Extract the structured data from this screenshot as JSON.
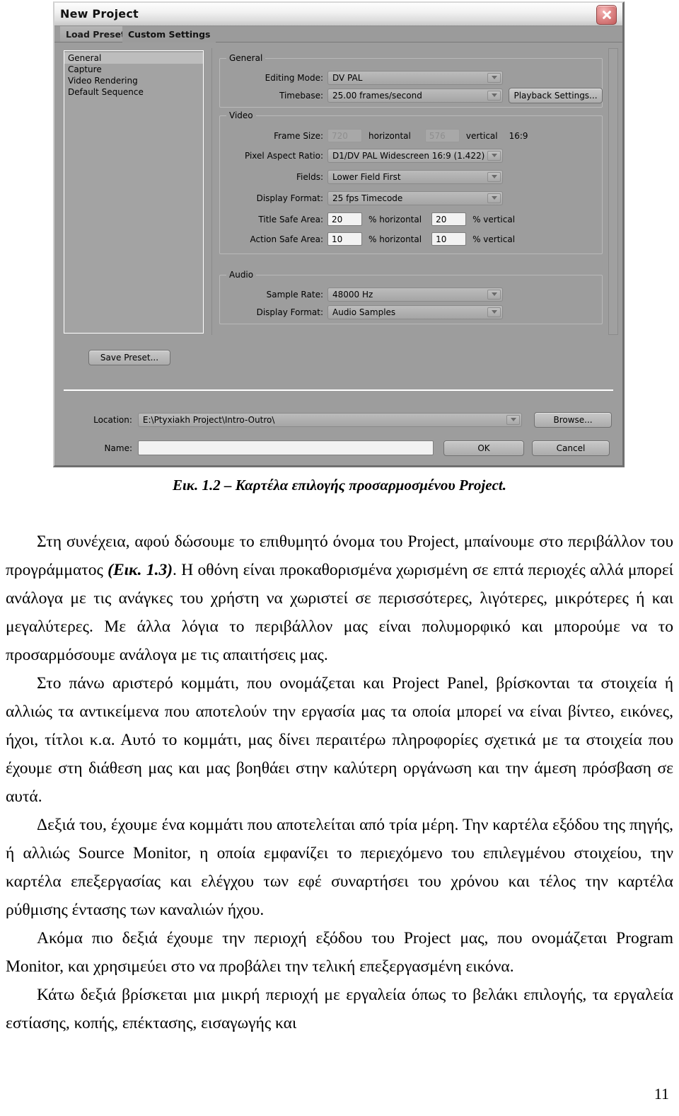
{
  "dialog": {
    "title": "New Project",
    "close_icon": "close-icon",
    "tabs": [
      {
        "label": "Load Preset",
        "active": false
      },
      {
        "label": "Custom Settings",
        "active": true
      }
    ],
    "tree": {
      "items": [
        {
          "label": "General",
          "selected": true
        },
        {
          "label": "Capture",
          "selected": false
        },
        {
          "label": "Video Rendering",
          "selected": false
        },
        {
          "label": "Default Sequence",
          "selected": false
        }
      ]
    },
    "groups": {
      "general": {
        "legend": "General",
        "editing_mode_label": "Editing Mode:",
        "editing_mode_value": "DV PAL",
        "timebase_label": "Timebase:",
        "timebase_value": "25.00 frames/second",
        "playback_settings_label": "Playback Settings..."
      },
      "video": {
        "legend": "Video",
        "frame_size_label": "Frame Size:",
        "frame_size_horizontal": "720",
        "horizontal_text": "horizontal",
        "frame_size_vertical": "576",
        "vertical_text": "vertical",
        "aspect_text": "16:9",
        "pixel_aspect_label": "Pixel Aspect Ratio:",
        "pixel_aspect_value": "D1/DV PAL Widescreen 16:9 (1.422)",
        "fields_label": "Fields:",
        "fields_value": "Lower Field First",
        "display_format_label": "Display Format:",
        "display_format_value": "25 fps Timecode",
        "title_safe_label": "Title Safe Area:",
        "title_safe_h": "20",
        "title_safe_h_unit": "% horizontal",
        "title_safe_v": "20",
        "title_safe_v_unit": "% vertical",
        "action_safe_label": "Action Safe Area:",
        "action_safe_h": "10",
        "action_safe_h_unit": "% horizontal",
        "action_safe_v": "10",
        "action_safe_v_unit": "% vertical"
      },
      "audio": {
        "legend": "Audio",
        "sample_rate_label": "Sample Rate:",
        "sample_rate_value": "48000 Hz",
        "display_format_label": "Display Format:",
        "display_format_value": "Audio Samples"
      }
    },
    "save_preset_label": "Save Preset...",
    "footer": {
      "location_label": "Location:",
      "location_value": "E:\\Ptyxiakh Project\\Intro-Outro\\",
      "browse_label": "Browse...",
      "name_label": "Name:",
      "name_value": "",
      "name_placeholder": "",
      "ok_label": "OK",
      "cancel_label": "Cancel"
    }
  },
  "caption": "Εικ. 1.2 – Καρτέλα επιλογής προσαρμοσμένου Project.",
  "body": {
    "p1_a": "Στη συνέχεια, αφού δώσουμε το επιθυμητό όνομα του Project, μπαίνουμε στο περιβάλλον του προγράμματος ",
    "p1_ref": "(Εικ. 1.3)",
    "p1_b": ". Η οθόνη είναι προκαθορισμένα χωρισμένη σε επτά περιοχές αλλά μπορεί ανάλογα με τις ανάγκες του χρήστη να χωριστεί σε περισσότερες, λιγότερες, μικρότερες ή και μεγαλύτερες. Με άλλα λόγια το περιβάλλον μας είναι πολυμορφικό και μπορούμε να το προσαρμόσουμε ανάλογα με τις απαιτήσεις μας.",
    "p2": "Στο πάνω αριστερό κομμάτι, που ονομάζεται και Project Panel, βρίσκονται τα στοιχεία ή αλλιώς τα αντικείμενα που αποτελούν την εργασία μας τα οποία μπορεί να είναι βίντεο, εικόνες, ήχοι, τίτλοι κ.α. Αυτό το κομμάτι, μας δίνει περαιτέρω πληροφορίες σχετικά με τα στοιχεία που έχουμε στη διάθεση μας και μας βοηθάει στην καλύτερη οργάνωση και την άμεση πρόσβαση σε αυτά.",
    "p3": "Δεξιά του, έχουμε ένα κομμάτι που αποτελείται από τρία μέρη. Την καρτέλα εξόδου της πηγής, ή αλλιώς Source Monitor, η οποία εμφανίζει το περιεχόμενο του επιλεγμένου στοιχείου, την καρτέλα επεξεργασίας και ελέγχου των εφέ συναρτήσει του χρόνου και τέλος την καρτέλα ρύθμισης έντασης των καναλιών ήχου.",
    "p4": "Ακόμα πιο δεξιά έχουμε την περιοχή εξόδου του Project μας, που ονομάζεται Program Monitor, και χρησιμεύει στο να προβάλει την τελική επεξεργασμένη εικόνα.",
    "p5": "Κάτω δεξιά  βρίσκεται μια μικρή περιοχή με εργαλεία όπως το βελάκι επιλογής, τα εργαλεία εστίασης, κοπής, επέκτασης, εισαγωγής και"
  },
  "page_number": "11"
}
